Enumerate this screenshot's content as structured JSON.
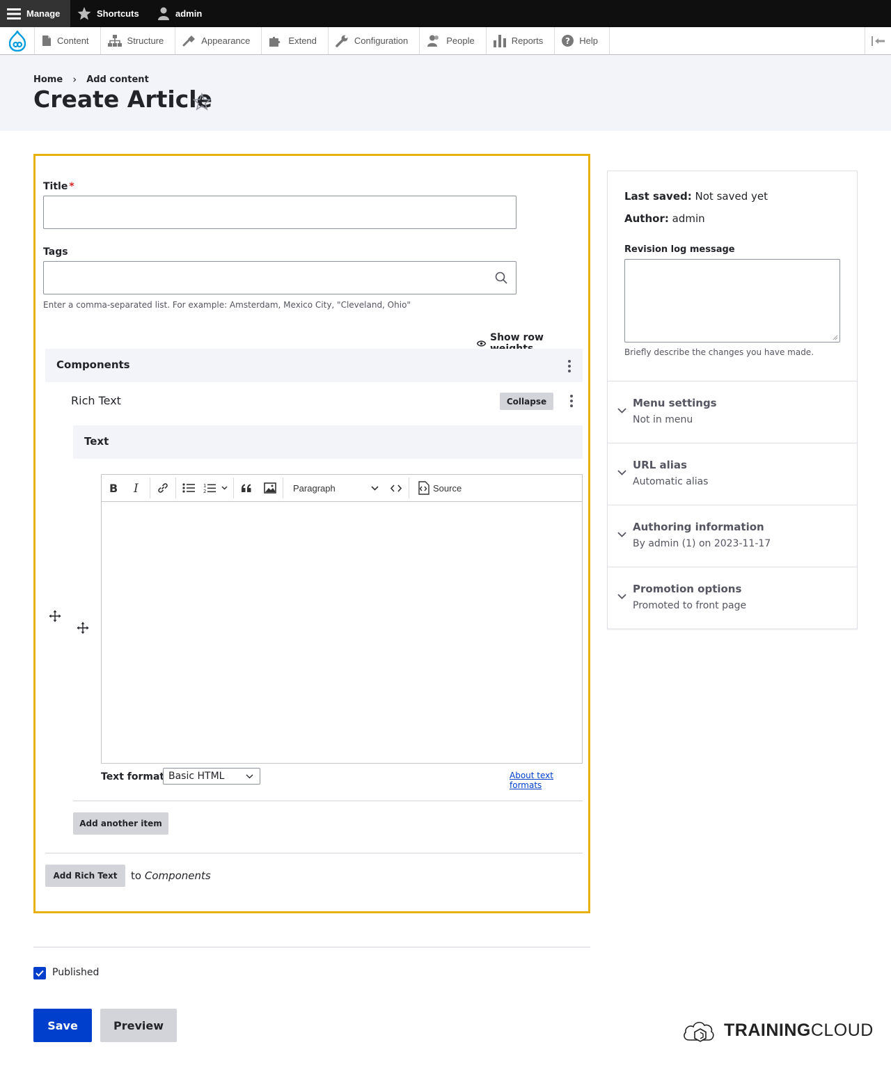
{
  "toolbar": {
    "manage": "Manage",
    "shortcuts": "Shortcuts",
    "user": "admin"
  },
  "tray": {
    "items": [
      "Content",
      "Structure",
      "Appearance",
      "Extend",
      "Configuration",
      "People",
      "Reports",
      "Help"
    ]
  },
  "breadcrumb": {
    "home": "Home",
    "separator": "›",
    "current": "Add content"
  },
  "page": {
    "title": "Create Article",
    "star": "☆"
  },
  "form": {
    "title_label": "Title",
    "required_marker": "*",
    "title_value": "",
    "tags_label": "Tags",
    "tags_value": "",
    "tags_description": "Enter a comma-separated list. For example: Amsterdam, Mexico City, \"Cleveland, Ohio\"",
    "show_row_weights": "Show row weights",
    "components_title": "Components",
    "rich_text_label": "Rich Text",
    "collapse_button": "Collapse",
    "text_title": "Text",
    "editor": {
      "paragraph_select": "Paragraph",
      "source_label": "Source",
      "content": ""
    },
    "text_format_label": "Text format",
    "text_format_value": "Basic HTML",
    "about_text_formats": "About text formats",
    "add_another_item": "Add another item",
    "add_rich_text": "Add Rich Text",
    "to_word": "to",
    "to_target": "Components"
  },
  "sidebar": {
    "last_saved_label": "Last saved:",
    "last_saved_value": "Not saved yet",
    "author_label": "Author:",
    "author_value": "admin",
    "revision_label": "Revision log message",
    "revision_value": "",
    "revision_description": "Briefly describe the changes you have made.",
    "sections": [
      {
        "title": "Menu settings",
        "summary": "Not in menu"
      },
      {
        "title": "URL alias",
        "summary": "Automatic alias"
      },
      {
        "title": "Authoring information",
        "summary": "By admin (1) on 2023-11-17"
      },
      {
        "title": "Promotion options",
        "summary": "Promoted to front page"
      }
    ]
  },
  "footer": {
    "published_label": "Published",
    "published_checked": true,
    "save_button": "Save",
    "preview_button": "Preview",
    "brand_bold": "TRAINING",
    "brand_light": "CLOUD"
  },
  "colors": {
    "accent_blue": "#003ecc",
    "highlight_border": "#e7b10f",
    "drupal_blue": "#009cde",
    "required_red": "#dc2323"
  }
}
